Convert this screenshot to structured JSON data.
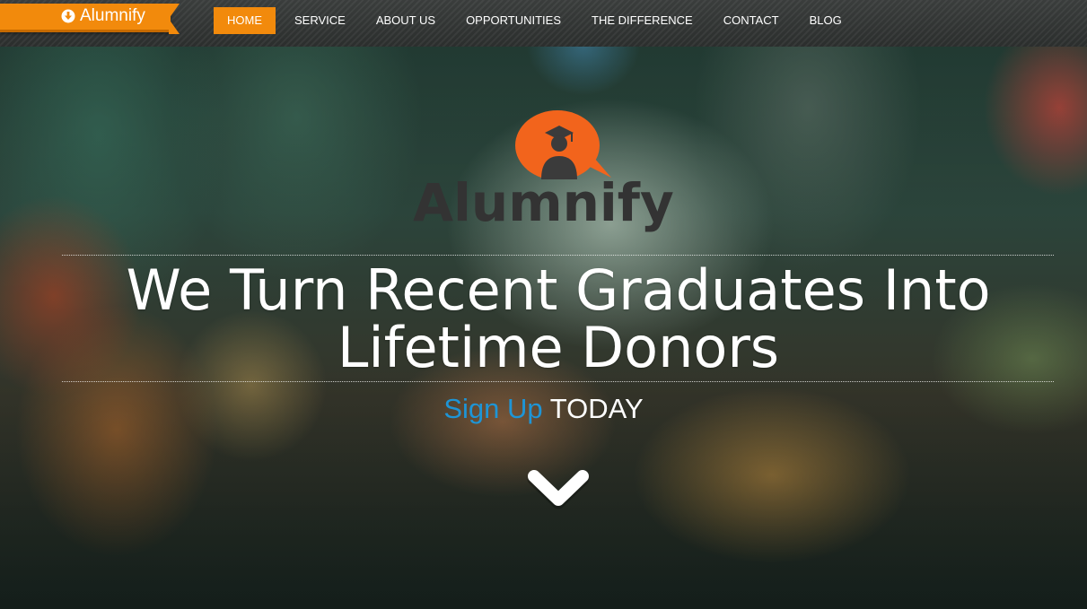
{
  "brand": {
    "name": "Alumnify",
    "icon": "download-circle-icon",
    "accent_color": "#f28a0c"
  },
  "nav": {
    "items": [
      {
        "label": "HOME",
        "active": true
      },
      {
        "label": "SERVICE",
        "active": false
      },
      {
        "label": "ABOUT US",
        "active": false
      },
      {
        "label": "OPPORTUNITIES",
        "active": false
      },
      {
        "label": "THE DIFFERENCE",
        "active": false
      },
      {
        "label": "CONTACT",
        "active": false
      },
      {
        "label": "BLOG",
        "active": false
      }
    ]
  },
  "hero": {
    "logo_icon": "graduate-speech-bubble-icon",
    "logo_text": "Alumnify",
    "headline_line1": "We Turn Recent Graduates Into",
    "headline_line2": "Lifetime Donors",
    "cta_link": "Sign Up",
    "cta_text": "TODAY",
    "cta_color": "#1e95d6",
    "scroll_icon": "chevron-down-icon"
  }
}
